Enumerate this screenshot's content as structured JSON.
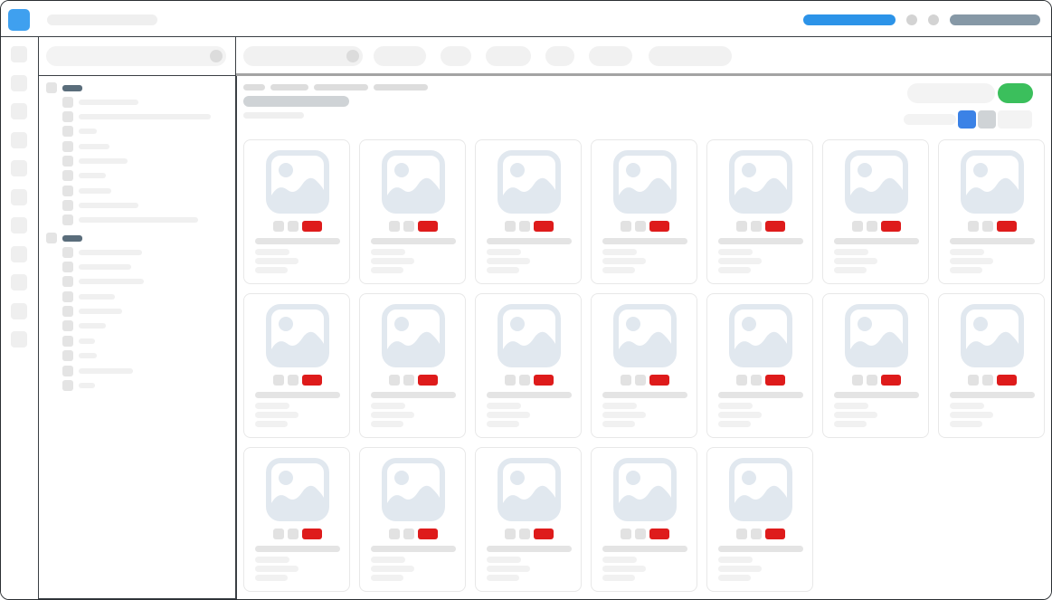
{
  "app": {
    "accent_color": "#3fa0ef",
    "primary_action_color": "#2c93e8",
    "success_color": "#3bbf5c",
    "badge_color": "#de1b1b"
  },
  "topbar": {
    "logo_icon": "app-logo-icon",
    "notification_icon": "notification-icon",
    "settings_icon": "settings-icon"
  },
  "rail": {
    "items": [
      "rail-item-1",
      "rail-item-2",
      "rail-item-3",
      "rail-item-4",
      "rail-item-5",
      "rail-item-6",
      "rail-item-7",
      "rail-item-8",
      "rail-item-9",
      "rail-item-10",
      "rail-item-11"
    ]
  },
  "tree": {
    "groups": [
      {
        "name": "group-1",
        "children": 9
      },
      {
        "name": "group-2",
        "children": 10
      }
    ]
  },
  "filters": {
    "search_icon": "search-icon",
    "count": 7
  },
  "gallery": {
    "view_modes": [
      "grid-view-icon",
      "list-view-icon",
      "more-view-options"
    ],
    "active_view": "grid-view-icon",
    "card_count": 19,
    "thumbnail_icon": "image-placeholder-icon"
  }
}
